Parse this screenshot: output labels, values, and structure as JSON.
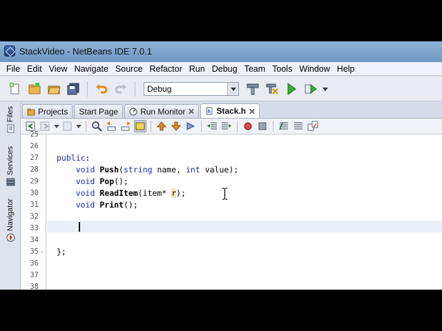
{
  "window": {
    "title": "StackVideo - NetBeans IDE 7.0.1"
  },
  "menu": [
    "File",
    "Edit",
    "View",
    "Navigate",
    "Source",
    "Refactor",
    "Run",
    "Debug",
    "Team",
    "Tools",
    "Window",
    "Help"
  ],
  "toolbar": {
    "configuration": "Debug",
    "icons": [
      "new-file-icon",
      "new-project-icon",
      "open-project-icon",
      "save-all-icon",
      "undo-icon",
      "redo-icon",
      "build-icon",
      "clean-build-icon",
      "run-icon",
      "debug-icon"
    ]
  },
  "side_tabs": [
    "Files",
    "Services",
    "Navigator"
  ],
  "tabs": [
    {
      "label": "Projects",
      "active": false
    },
    {
      "label": "Start Page",
      "active": false
    },
    {
      "label": "Run Monitor",
      "active": false
    },
    {
      "label": "Stack.h",
      "active": true
    }
  ],
  "editor": {
    "lines": [
      {
        "num": "25",
        "text": ""
      },
      {
        "num": "26",
        "text": ""
      },
      {
        "num": "27",
        "text": "public:"
      },
      {
        "num": "28",
        "text": "    void Push(string name, int value);"
      },
      {
        "num": "29",
        "text": "    void Pop();"
      },
      {
        "num": "30",
        "text": "    void ReadItem(item* r);"
      },
      {
        "num": "31",
        "text": "    void Print();"
      },
      {
        "num": "32",
        "text": ""
      },
      {
        "num": "33",
        "text": ""
      },
      {
        "num": "34",
        "text": ""
      },
      {
        "num": "35",
        "text": "};"
      },
      {
        "num": "36",
        "text": ""
      },
      {
        "num": "37",
        "text": ""
      },
      {
        "num": "38",
        "text": ""
      }
    ],
    "current_line": "33"
  },
  "colors": {
    "keyword": "#1b27b8",
    "current_line": "#e9eff8",
    "titlebar": "#7fa6d1"
  }
}
